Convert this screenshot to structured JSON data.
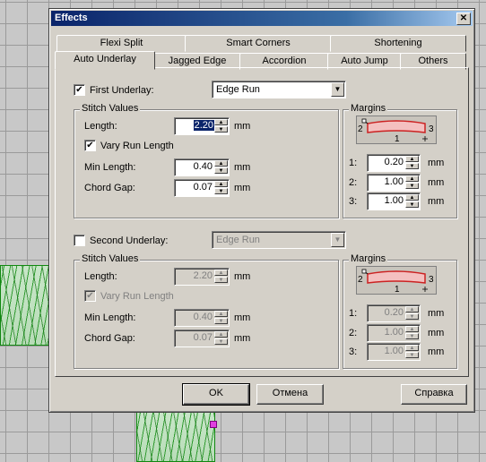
{
  "window": {
    "title": "Effects",
    "close_glyph": "✕"
  },
  "tabs_row1": [
    "Flexi Split",
    "Smart Corners",
    "Shortening"
  ],
  "tabs_row2": [
    "Auto Underlay",
    "Jagged Edge",
    "Accordion",
    "Auto Jump",
    "Others"
  ],
  "first": {
    "checkbox_label": "First Underlay:",
    "checked": true,
    "type_value": "Edge Run",
    "stitch_group": "Stitch Values",
    "length_label": "Length:",
    "length_value": "2.20",
    "unit": "mm",
    "vary_label": "Vary Run Length",
    "vary_checked": true,
    "min_label": "Min Length:",
    "min_value": "0.40",
    "chord_label": "Chord Gap:",
    "chord_value": "0.07",
    "margins_group": "Margins",
    "diagram_labels": [
      "2",
      "1",
      "3"
    ],
    "margins": [
      {
        "label": "1:",
        "value": "0.20"
      },
      {
        "label": "2:",
        "value": "1.00"
      },
      {
        "label": "3:",
        "value": "1.00"
      }
    ]
  },
  "second": {
    "checkbox_label": "Second Underlay:",
    "checked": false,
    "type_value": "Edge Run",
    "stitch_group": "Stitch Values",
    "length_label": "Length:",
    "length_value": "2.20",
    "unit": "mm",
    "vary_label": "Vary Run Length",
    "vary_checked": true,
    "min_label": "Min Length:",
    "min_value": "0.40",
    "chord_label": "Chord Gap:",
    "chord_value": "0.07",
    "margins_group": "Margins",
    "diagram_labels": [
      "2",
      "1",
      "3"
    ],
    "margins": [
      {
        "label": "1:",
        "value": "0.20"
      },
      {
        "label": "2:",
        "value": "1.00"
      },
      {
        "label": "3:",
        "value": "1.00"
      }
    ]
  },
  "buttons": {
    "ok": "OK",
    "cancel": "Отмена",
    "help": "Справка"
  },
  "colors": {
    "title_bar": "#0a246a",
    "dialog_bg": "#d4d0c8",
    "stitch_green": "#2f9a2f",
    "diagram_red": "#cc2222"
  }
}
